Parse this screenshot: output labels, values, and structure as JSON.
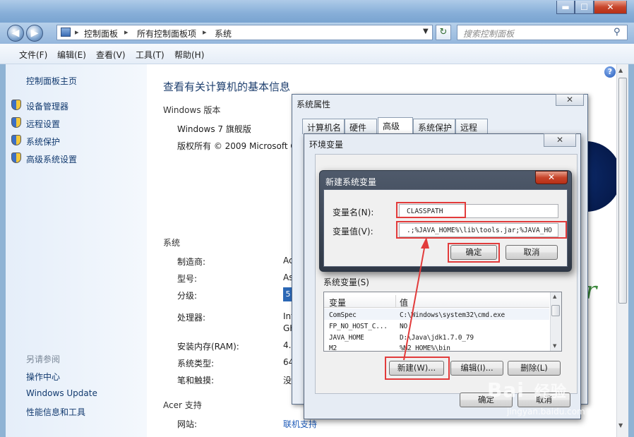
{
  "window": {
    "minimize": "▬",
    "maximize": "☐",
    "close": "✕"
  },
  "nav": {
    "back": "◀",
    "forward": "▶",
    "breadcrumb": [
      "控制面板",
      "所有控制面板项",
      "系统"
    ],
    "search_placeholder": "搜索控制面板"
  },
  "menu": [
    "文件(F)",
    "编辑(E)",
    "查看(V)",
    "工具(T)",
    "帮助(H)"
  ],
  "sidebar": {
    "home": "控制面板主页",
    "items": [
      "设备管理器",
      "远程设置",
      "系统保护",
      "高级系统设置"
    ],
    "see_also_title": "另请参阅",
    "see_also": [
      "操作中心",
      "Windows Update",
      "性能信息和工具"
    ]
  },
  "main": {
    "heading": "查看有关计算机的基本信息",
    "edition_section": "Windows 版本",
    "edition": "Windows 7 旗舰版",
    "copyright": "版权所有 © 2009 Microsoft C",
    "system_section": "系统",
    "fields": [
      {
        "label": "制造商:",
        "value": "Ac"
      },
      {
        "label": "型号:",
        "value": "As"
      },
      {
        "label": "分级:",
        "value": "5"
      },
      {
        "label": "处理器:",
        "value": "Int"
      },
      {
        "label": "",
        "value": "GH"
      },
      {
        "label": "安装内存(RAM):",
        "value": "4.0"
      },
      {
        "label": "系统类型:",
        "value": "64"
      },
      {
        "label": "笔和触摸:",
        "value": "没"
      }
    ],
    "support_section": "Acer 支持",
    "website_label": "网站:",
    "website_link": "联机支持"
  },
  "system_properties": {
    "title": "系统属性",
    "close": "✕",
    "tabs": [
      "计算机名",
      "硬件",
      "高级",
      "系统保护",
      "远程"
    ],
    "active_tab": "高级"
  },
  "env_dialog": {
    "title": "环境变量",
    "close": "✕",
    "system_vars_label": "系统变量(S)",
    "columns": [
      "变量",
      "值"
    ],
    "rows": [
      {
        "name": "ComSpec",
        "value": "C:\\Windows\\system32\\cmd.exe"
      },
      {
        "name": "FP_NO_HOST_C...",
        "value": "NO"
      },
      {
        "name": "JAVA_HOME",
        "value": "D:\\Java\\jdk1.7.0_79"
      },
      {
        "name": "M2",
        "value": "%M2_HOME%\\bin"
      }
    ],
    "new_button": "新建(W)...",
    "edit_button": "编辑(I)...",
    "delete_button": "删除(L)",
    "ok_button": "确定",
    "cancel_button": "取消"
  },
  "new_var_dialog": {
    "title": "新建系统变量",
    "close": "✕",
    "name_label": "变量名(N):",
    "name_value": "CLASSPATH",
    "value_label": "变量值(V):",
    "value_value": ".;%JAVA_HOME%\\lib\\tools.jar;%JAVA_HO",
    "ok_button": "确定",
    "cancel_button": "取消"
  },
  "watermark": {
    "main": "Bai",
    "suffix": "经验",
    "sub": "jingyan.baidu.com"
  },
  "colors": {
    "highlight": "#e23b3b",
    "link": "#123a6f",
    "accent": "#1e3f6e"
  }
}
